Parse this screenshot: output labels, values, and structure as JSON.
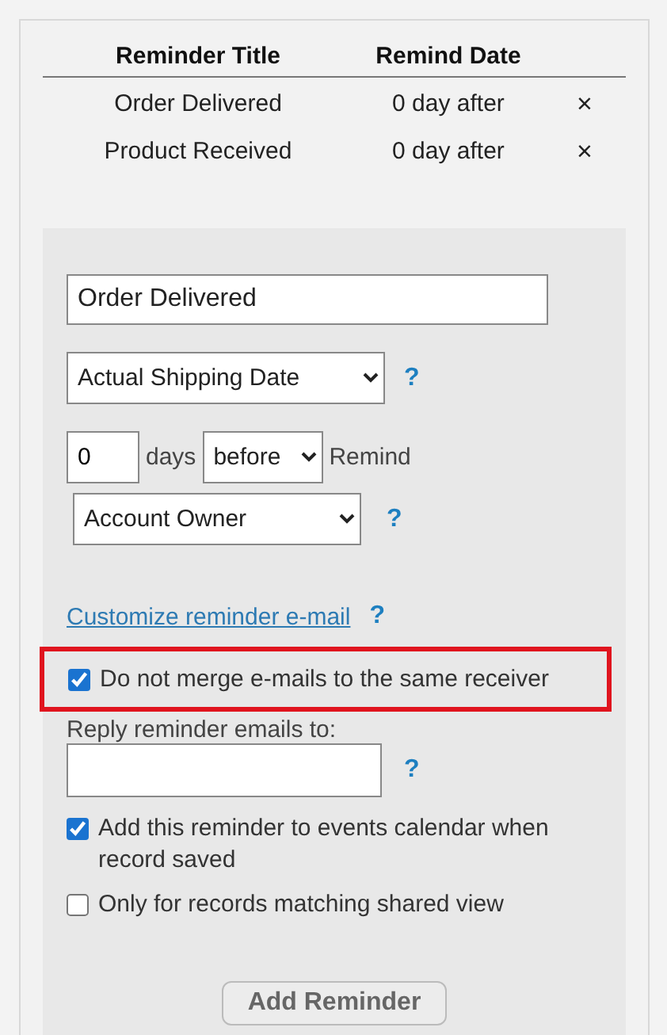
{
  "table": {
    "columns": [
      "Reminder Title",
      "Remind Date"
    ],
    "rows": [
      {
        "title": "Order Delivered",
        "date": "0 day after",
        "remove": "×"
      },
      {
        "title": "Product Received",
        "date": "0 day after",
        "remove": "×"
      }
    ]
  },
  "form": {
    "title_value": "Order Delivered",
    "date_field": "Actual Shipping Date",
    "help": "?",
    "days_value": "0",
    "days_label": "days",
    "direction": "before",
    "remind_label": "Remind",
    "recipient": "Account Owner",
    "customize_link": "Customize reminder e-mail",
    "merge_option": {
      "label": "Do not merge e-mails to the same receiver",
      "checked": true,
      "highlighted": true
    },
    "reply_label": "Reply reminder emails to:",
    "options": [
      {
        "label": "Add this reminder to events calendar when record saved",
        "checked": true
      },
      {
        "label": "Only for records matching shared view",
        "checked": false
      }
    ],
    "button": "Add Reminder"
  }
}
